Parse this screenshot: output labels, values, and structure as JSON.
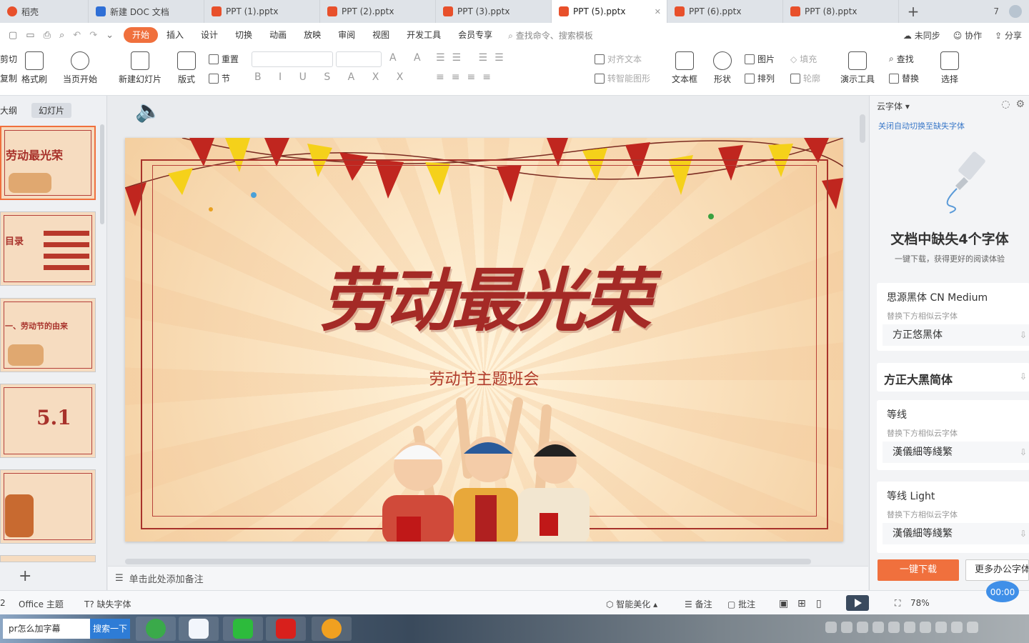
{
  "tabs": [
    {
      "label": "稻壳",
      "color": "#e8502b"
    },
    {
      "label": "新建 DOC 文档",
      "color": "#2f6fd6"
    },
    {
      "label": "PPT (1).pptx",
      "color": "#e8502b"
    },
    {
      "label": "PPT (2).pptx",
      "color": "#e8502b"
    },
    {
      "label": "PPT (3).pptx",
      "color": "#e8502b"
    },
    {
      "label": "PPT (5).pptx",
      "color": "#e8502b"
    },
    {
      "label": "PPT (6).pptx",
      "color": "#e8502b"
    },
    {
      "label": "PPT (8).pptx",
      "color": "#e8502b"
    }
  ],
  "tab_add": "+",
  "tab_right_badge": "7",
  "menu": {
    "items": [
      "开始",
      "插入",
      "设计",
      "切换",
      "动画",
      "放映",
      "审阅",
      "视图",
      "开发工具",
      "会员专享"
    ],
    "search": "查找命令、搜索模板",
    "right": [
      "未同步",
      "协作",
      "分享"
    ]
  },
  "ribbon": {
    "cut": "剪切",
    "copy": "复制",
    "format_painter": "格式刷",
    "from_current": "当页开始",
    "new_slide": "新建幻灯片",
    "layout": "版式",
    "reset": "重置",
    "section": "节",
    "align_text": "对齐文本",
    "smart_graphic": "转智能图形",
    "textbox": "文本框",
    "shape": "形状",
    "picture": "图片",
    "fill": "填充",
    "arrange": "排列",
    "outline": "轮廓",
    "present_tools": "演示工具",
    "find": "查找",
    "replace": "替换",
    "select": "选择"
  },
  "left_panel": {
    "tabs": [
      "大纲",
      "幻灯片"
    ],
    "thumb_titles": [
      "劳动最光荣",
      "目录",
      "一、劳动节的由来",
      "5.1",
      ""
    ]
  },
  "slide": {
    "title": "劳动最光荣",
    "subtitle": "劳动节主题班会"
  },
  "notes_placeholder": "单击此处添加备注",
  "right_panel": {
    "header": "云字体",
    "link": "关闭自动切换至缺失字体",
    "title": "文档中缺失4个字体",
    "desc": "一键下载，获得更好的阅读体验",
    "fonts": [
      {
        "name": "思源黑体 CN Medium",
        "hint": "替换下方相似云字体",
        "replace": "方正悠黑体"
      },
      {
        "name": "方正大黑简体",
        "hint": "",
        "replace": ""
      },
      {
        "name": "等线",
        "hint": "替换下方相似云字体",
        "replace": "漢儀細等綫繁"
      },
      {
        "name": "等线 Light",
        "hint": "替换下方相似云字体",
        "replace": "漢儀細等綫繁"
      }
    ],
    "download_button": "一键下载",
    "more_button": "更多办公字体"
  },
  "status": {
    "page": "2",
    "theme": "Office 主题",
    "missing_font": "缺失字体",
    "beautify": "智能美化",
    "notes": "备注",
    "comment": "批注",
    "zoom": "78%",
    "timer": "00:00"
  },
  "taskbar": {
    "search_value": "pr怎么加字幕",
    "search_button": "搜索一下"
  }
}
